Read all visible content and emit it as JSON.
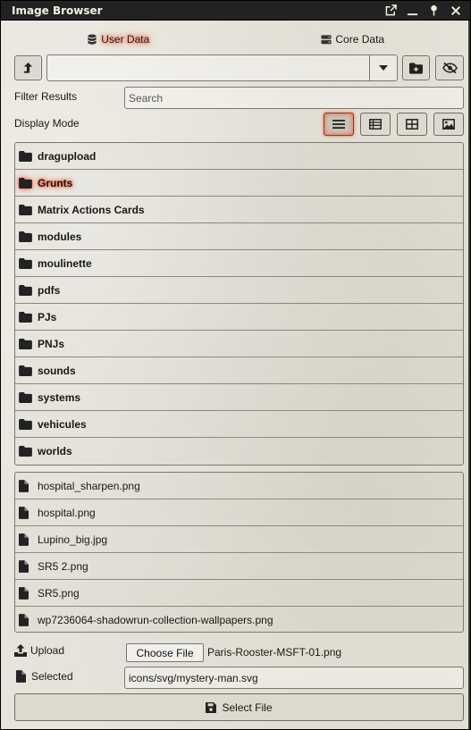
{
  "window": {
    "title": "Image Browser"
  },
  "tabs": [
    {
      "label": "User Data",
      "active": true
    },
    {
      "label": "Core Data",
      "active": false
    }
  ],
  "toolbar": {
    "source_value": ""
  },
  "filter": {
    "label": "Filter Results",
    "placeholder": "Search"
  },
  "display": {
    "label": "Display Mode",
    "active_mode": "list",
    "modes": [
      "list",
      "table",
      "tiles",
      "images"
    ]
  },
  "folders": [
    {
      "name": "dragupload"
    },
    {
      "name": "Grunts",
      "active": true
    },
    {
      "name": "Matrix Actions Cards"
    },
    {
      "name": "modules"
    },
    {
      "name": "moulinette"
    },
    {
      "name": "pdfs"
    },
    {
      "name": "PJs"
    },
    {
      "name": "PNJs"
    },
    {
      "name": "sounds"
    },
    {
      "name": "systems"
    },
    {
      "name": "vehicules"
    },
    {
      "name": "worlds"
    }
  ],
  "files": [
    {
      "name": "hospital_sharpen.png"
    },
    {
      "name": "hospital.png"
    },
    {
      "name": "Lupino_big.jpg"
    },
    {
      "name": "SR5 2.png"
    },
    {
      "name": "SR5.png"
    },
    {
      "name": "wp7236064-shadowrun-collection-wallpapers.png"
    }
  ],
  "upload": {
    "label": "Upload",
    "button_label": "Choose File",
    "file_name": "Paris-Rooster-MSFT-01.png"
  },
  "selected": {
    "label": "Selected",
    "value": "icons/svg/mystery-man.svg"
  },
  "submit": {
    "label": "Select File"
  },
  "colors": {
    "accent_glow": "#ff3a1a",
    "titlebar": "#222222",
    "background": "#e6e3da"
  }
}
